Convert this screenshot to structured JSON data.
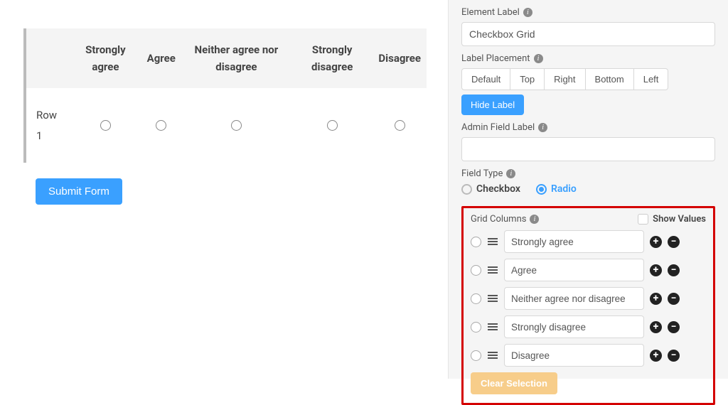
{
  "preview": {
    "columns": [
      "Strongly agree",
      "Agree",
      "Neither agree nor disagree",
      "Strongly disagree",
      "Disagree"
    ],
    "rows": [
      "Row 1"
    ],
    "submit_label": "Submit Form"
  },
  "panel": {
    "element_label_title": "Element Label",
    "element_label_value": "Checkbox Grid",
    "label_placement_title": "Label Placement",
    "placement_options": [
      "Default",
      "Top",
      "Right",
      "Bottom",
      "Left"
    ],
    "hide_label": "Hide Label",
    "admin_label_title": "Admin Field Label",
    "admin_label_value": "",
    "field_type_title": "Field Type",
    "field_type_options": [
      "Checkbox",
      "Radio"
    ],
    "field_type_selected": "Radio",
    "grid_columns_title": "Grid Columns",
    "show_values_label": "Show Values",
    "columns": [
      "Strongly agree",
      "Agree",
      "Neither agree nor disagree",
      "Strongly disagree",
      "Disagree"
    ],
    "clear_selection": "Clear Selection"
  }
}
